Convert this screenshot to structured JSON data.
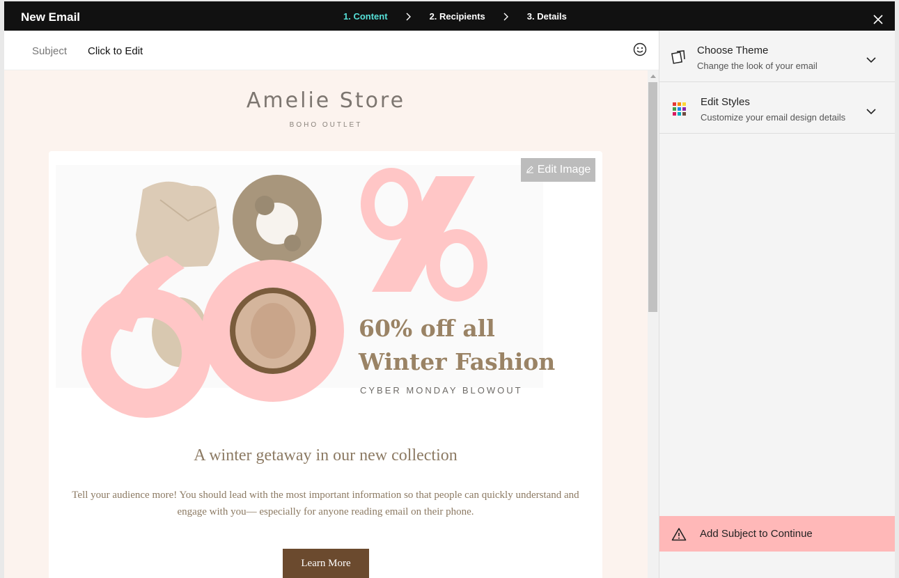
{
  "window": {
    "title": "New Email",
    "steps": [
      {
        "label": "1. Content",
        "active": true
      },
      {
        "label": "2. Recipients",
        "active": false
      },
      {
        "label": "3. Details",
        "active": false
      }
    ],
    "close_icon": "close-icon"
  },
  "subject": {
    "label": "Subject",
    "value": "Click to Edit",
    "emoji_icon": "smiley-icon"
  },
  "email": {
    "store_name": "Amelie Store",
    "store_tagline": "BOHO OUTLET",
    "edit_image_label": "Edit Image",
    "promo_title": "60% off all\nWinter Fashion",
    "promo_subtitle": "CYBER MONDAY BLOWOUT",
    "hero_graphic": "60%",
    "heading": "A winter getaway in our new collection",
    "body": "Tell your audience more! You should lead with the most important information so that people can quickly understand and engage with you— especially for anyone reading email on their phone.",
    "cta_label": "Learn More"
  },
  "sidebar": {
    "items": [
      {
        "title": "Choose Theme",
        "subtitle": "Change the look of your email",
        "icon": "theme-cards-icon"
      },
      {
        "title": "Edit Styles",
        "subtitle": "Customize your email design details",
        "icon": "color-palette-icon"
      }
    ],
    "alert": {
      "label": "Add Subject to Continue",
      "icon": "warning-icon"
    }
  },
  "colors": {
    "accent_step": "#56e0d8",
    "promo_pink": "#ffc6c6",
    "promo_brown": "#9a8365",
    "cta_bg": "#6b4a2e",
    "alert_bg": "#ffb8b8"
  }
}
